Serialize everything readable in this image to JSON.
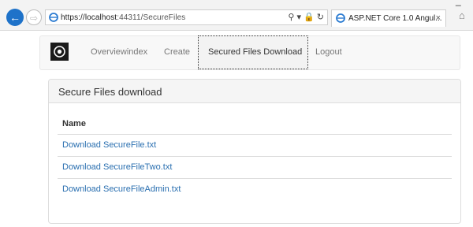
{
  "browser": {
    "window_minimize": "_",
    "back": "←",
    "forward": "⇨",
    "url_host": "https://localhost",
    "url_rest": ":44311/SecureFiles",
    "address_tools": "⚲ ▾ 🔒 ↻",
    "tab_title": "ASP.NET Core 1.0 Angul...",
    "tab_close": "×",
    "home": "⌂"
  },
  "navbar": {
    "items": [
      {
        "label": "Overviewindex"
      },
      {
        "label": "Create"
      },
      {
        "label": "Secured Files Download"
      },
      {
        "label": "Logout"
      }
    ],
    "active_index": 2
  },
  "panel": {
    "title": "Secure Files download",
    "column_header": "Name",
    "files": [
      {
        "link": "Download SecureFile.txt"
      },
      {
        "link": "Download SecureFileTwo.txt"
      },
      {
        "link": "Download SecureFileAdmin.txt"
      }
    ]
  },
  "colors": {
    "link": "#2a6fb0",
    "back_button": "#1e72c9"
  },
  "icons": [
    "back-arrow-icon",
    "forward-arrow-icon",
    "ie-page-icon",
    "search-icon",
    "lock-icon",
    "refresh-icon",
    "close-icon",
    "home-icon",
    "app-logo-icon"
  ]
}
